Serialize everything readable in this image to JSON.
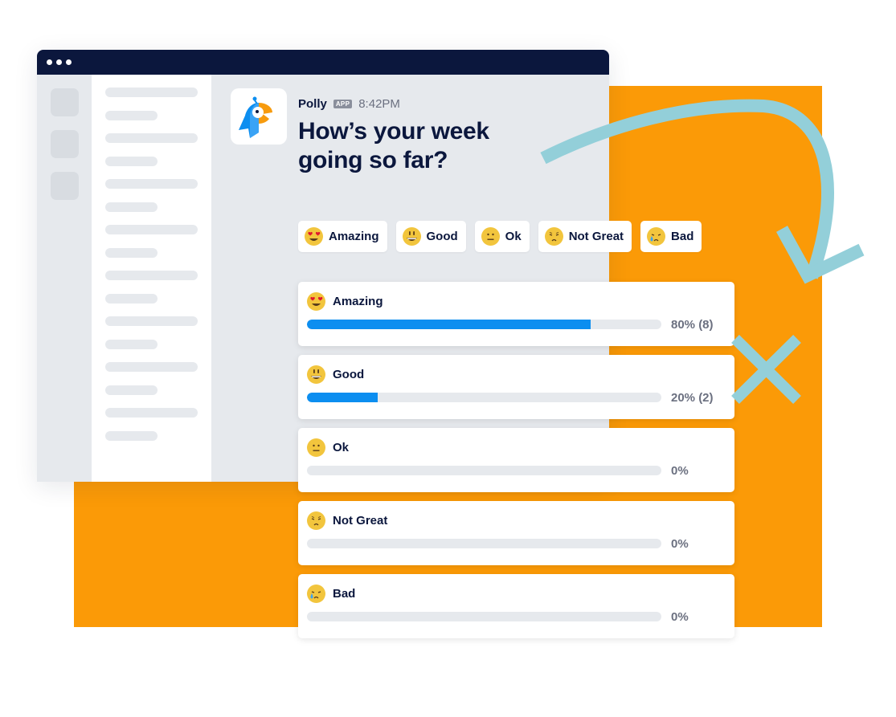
{
  "window": {
    "title_dots": 3,
    "rail_items": 3,
    "channel_placeholder_lines": [
      "long",
      "short",
      "long",
      "short",
      "long",
      "short",
      "long",
      "short",
      "long",
      "short",
      "long",
      "short",
      "long",
      "short",
      "long",
      "short"
    ]
  },
  "message": {
    "sender": "Polly",
    "badge": "APP",
    "time": "8:42PM",
    "question": "How’s your week going so far?",
    "avatar_icon": "polly-parrot-logo"
  },
  "options": [
    {
      "label": "Amazing",
      "emoji": "heart-eyes"
    },
    {
      "label": "Good",
      "emoji": "grinning"
    },
    {
      "label": "Ok",
      "emoji": "neutral"
    },
    {
      "label": "Not Great",
      "emoji": "disappointed"
    },
    {
      "label": "Bad",
      "emoji": "crying"
    }
  ],
  "results": [
    {
      "label": "Amazing",
      "emoji": "heart-eyes",
      "percent": 80,
      "votes": 8,
      "display": "80% (8)"
    },
    {
      "label": "Good",
      "emoji": "grinning",
      "percent": 20,
      "votes": 2,
      "display": "20% (2)"
    },
    {
      "label": "Ok",
      "emoji": "neutral",
      "percent": 0,
      "votes": 0,
      "display": "0%"
    },
    {
      "label": "Not Great",
      "emoji": "disappointed",
      "percent": 0,
      "votes": 0,
      "display": "0%"
    },
    {
      "label": "Bad",
      "emoji": "crying",
      "percent": 0,
      "votes": 0,
      "display": "0%"
    }
  ],
  "colors": {
    "brand_navy": "#0b173d",
    "accent_orange": "#fb9a07",
    "bar_blue": "#0c8ef0",
    "decor_teal": "#93cfd9"
  }
}
